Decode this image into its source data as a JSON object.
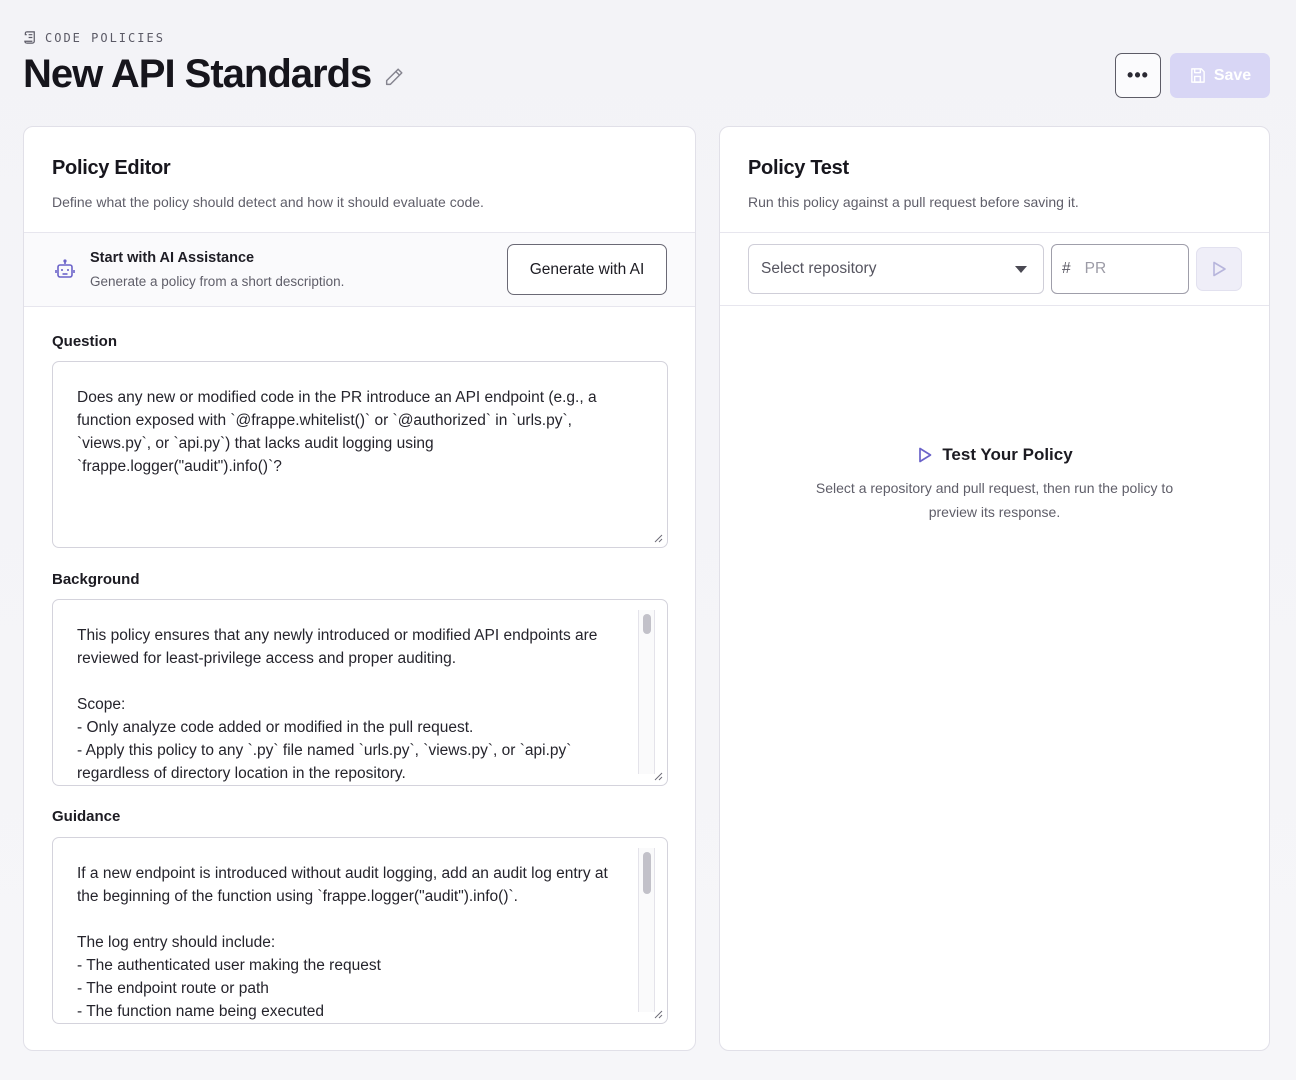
{
  "header": {
    "eyebrow": "CODE POLICIES",
    "title": "New API Standards",
    "more_label": "•••",
    "save_label": "Save"
  },
  "editor": {
    "title": "Policy Editor",
    "subtitle": "Define what the policy should detect and how it should evaluate code.",
    "ai": {
      "title": "Start with AI Assistance",
      "subtitle": "Generate a policy from a short description.",
      "button": "Generate with AI"
    },
    "question": {
      "label": "Question",
      "value": "Does any new or modified code in the PR introduce an API endpoint (e.g., a\nfunction exposed with `@frappe.whitelist()` or `@authorized` in `urls.py`,\n`views.py`, or `api.py`) that lacks audit logging using\n`frappe.logger(\"audit\").info()`?"
    },
    "background": {
      "label": "Background",
      "value": "This policy ensures that any newly introduced or modified API endpoints are\nreviewed for least-privilege access and proper auditing.\n\nScope:\n- Only analyze code added or modified in the pull request.\n- Apply this policy to any `.py` file named `urls.py`, `views.py`, or `api.py`\nregardless of directory location in the repository."
    },
    "guidance": {
      "label": "Guidance",
      "value": "If a new endpoint is introduced without audit logging, add an audit log entry at\nthe beginning of the function using `frappe.logger(\"audit\").info()`.\n\nThe log entry should include:\n- The authenticated user making the request\n- The endpoint route or path\n- The function name being executed"
    }
  },
  "test": {
    "title": "Policy Test",
    "subtitle": "Run this policy against a pull request before saving it.",
    "repo_placeholder": "Select repository",
    "pr_hash": "#",
    "pr_placeholder": "PR",
    "empty_title": "Test Your Policy",
    "empty_sub": "Select a repository and pull request, then run the policy to preview its response."
  },
  "colors": {
    "accent": "#6b63c9",
    "save_disabled": "#d8d6f5"
  }
}
